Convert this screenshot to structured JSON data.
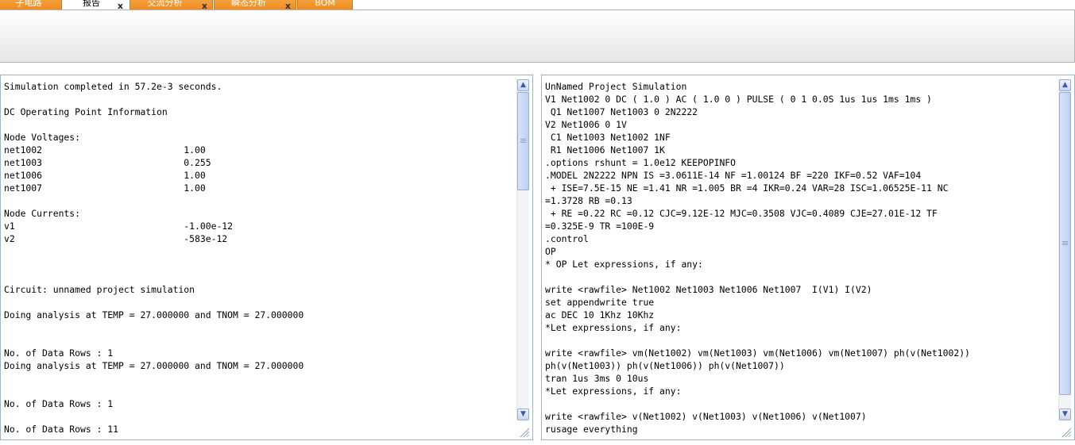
{
  "tabs": [
    {
      "label": "子电路",
      "closable": false,
      "active": false
    },
    {
      "label": "报告",
      "closable": true,
      "active": true
    },
    {
      "label": "交流分析",
      "closable": true,
      "active": false
    },
    {
      "label": "瞬态分析",
      "closable": true,
      "active": false
    },
    {
      "label": "BOM",
      "closable": false,
      "active": false
    }
  ],
  "close_glyph": "x",
  "left_pane": {
    "lines": [
      "Simulation completed in 57.2e-3 seconds.",
      "",
      "DC Operating Point Information",
      "",
      "Node Voltages:",
      "net1002                          1.00",
      "net1003                          0.255",
      "net1006                          1.00",
      "net1007                          1.00",
      "",
      "Node Currents:",
      "v1                               -1.00e-12",
      "v2                               -583e-12",
      "",
      "",
      "",
      "Circuit: unnamed project simulation",
      "",
      "Doing analysis at TEMP = 27.000000 and TNOM = 27.000000",
      "",
      "",
      "No. of Data Rows : 1",
      "Doing analysis at TEMP = 27.000000 and TNOM = 27.000000",
      "",
      "",
      "No. of Data Rows : 1",
      "",
      "No. of Data Rows : 11"
    ]
  },
  "right_pane": {
    "lines": [
      "UnNamed Project Simulation",
      "V1 Net1002 0 DC ( 1.0 ) AC ( 1.0 0 ) PULSE ( 0 1 0.0S 1us 1us 1ms 1ms )",
      " Q1 Net1007 Net1003 0 2N2222",
      "V2 Net1006 0 1V",
      " C1 Net1003 Net1002 1NF",
      " R1 Net1006 Net1007 1K",
      ".options rshunt = 1.0e12 KEEPOPINFO",
      ".MODEL 2N2222 NPN IS =3.0611E-14 NF =1.00124 BF =220 IKF=0.52 VAF=104",
      " + ISE=7.5E-15 NE =1.41 NR =1.005 BR =4 IKR=0.24 VAR=28 ISC=1.06525E-11 NC",
      "=1.3728 RB =0.13",
      " + RE =0.22 RC =0.12 CJC=9.12E-12 MJC=0.3508 VJC=0.4089 CJE=27.01E-12 TF",
      "=0.325E-9 TR =100E-9",
      ".control",
      "OP",
      "* OP Let expressions, if any:",
      "",
      "write <rawfile> Net1002 Net1003 Net1006 Net1007  I(V1) I(V2)",
      "set appendwrite true",
      "ac DEC 10 1Khz 10Khz",
      "*Let expressions, if any:",
      "",
      "write <rawfile> vm(Net1002) vm(Net1003) vm(Net1006) vm(Net1007) ph(v(Net1002))",
      "ph(v(Net1003)) ph(v(Net1006)) ph(v(Net1007))",
      "tran 1us 3ms 0 10us",
      "*Let expressions, if any:",
      "",
      "write <rawfile> v(Net1002) v(Net1003) v(Net1006) v(Net1007)",
      "rusage everything"
    ]
  },
  "scroll_up_glyph": "▲",
  "scroll_down_glyph": "▼"
}
